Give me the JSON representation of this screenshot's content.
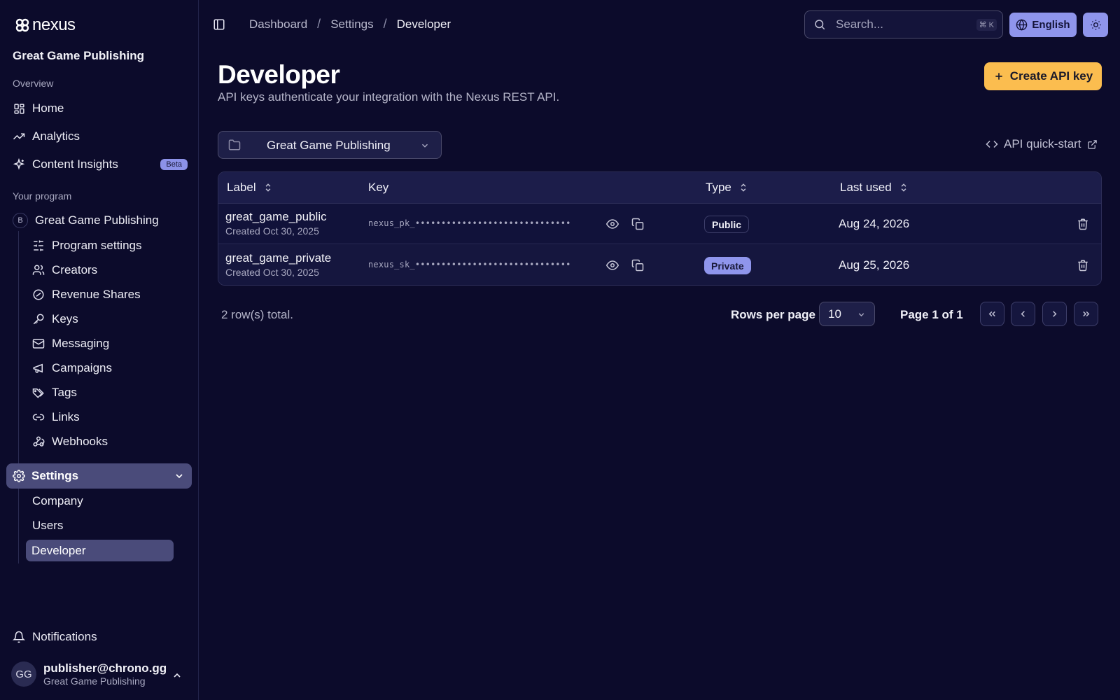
{
  "app": {
    "logo_text": "nexus",
    "org_name": "Great Game Publishing"
  },
  "sidebar": {
    "overview_label": "Overview",
    "overview_items": [
      {
        "label": "Home",
        "icon": "grid-icon"
      },
      {
        "label": "Analytics",
        "icon": "trend-icon"
      },
      {
        "label": "Content Insights",
        "icon": "sparkle-icon",
        "badge": "Beta"
      }
    ],
    "program_label": "Your program",
    "program": {
      "badge": "B",
      "name": "Great Game Publishing"
    },
    "program_items": [
      {
        "label": "Program settings",
        "icon": "sliders-icon"
      },
      {
        "label": "Creators",
        "icon": "users-icon"
      },
      {
        "label": "Revenue Shares",
        "icon": "revenue-icon"
      },
      {
        "label": "Keys",
        "icon": "key-icon"
      },
      {
        "label": "Messaging",
        "icon": "mail-icon"
      },
      {
        "label": "Campaigns",
        "icon": "megaphone-icon"
      },
      {
        "label": "Tags",
        "icon": "tags-icon"
      },
      {
        "label": "Links",
        "icon": "link-icon"
      },
      {
        "label": "Webhooks",
        "icon": "webhook-icon"
      }
    ],
    "settings_label": "Settings",
    "settings_items": [
      "Company",
      "Users",
      "Developer"
    ],
    "notifications_label": "Notifications",
    "user": {
      "initials": "GG",
      "email": "publisher@chrono.gg",
      "org": "Great Game Publishing"
    }
  },
  "topbar": {
    "breadcrumb": [
      "Dashboard",
      "Settings",
      "Developer"
    ],
    "breadcrumb_sep": "/",
    "search_placeholder": "Search...",
    "search_shortcut": "⌘ K",
    "language": "English"
  },
  "page": {
    "title": "Developer",
    "description": "API keys authenticate your integration with the Nexus REST API.",
    "create_button": "Create API key",
    "program_select": "Great Game Publishing",
    "quickstart_link": "API quick-start"
  },
  "table": {
    "columns": [
      "Label",
      "Key",
      "Type",
      "Last used"
    ],
    "rows": [
      {
        "label": "great_game_public",
        "created": "Created Oct 30, 2025",
        "key": "nexus_pk_••••••••••••••••••••••••••••••",
        "type": "Public",
        "last_used": "Aug 24, 2026"
      },
      {
        "label": "great_game_private",
        "created": "Created Oct 30, 2025",
        "key": "nexus_sk_••••••••••••••••••••••••••••••",
        "type": "Private",
        "last_used": "Aug 25, 2026"
      }
    ]
  },
  "pagination": {
    "total": "2 row(s) total.",
    "rows_per_page_label": "Rows per page",
    "rows_per_page": "10",
    "page_info": "Page 1 of 1"
  },
  "colors": {
    "background": "#0c0b2b",
    "accent": "#8f95ec",
    "primary_button": "#fbbd4f",
    "active_nav": "#4a4b7a"
  }
}
